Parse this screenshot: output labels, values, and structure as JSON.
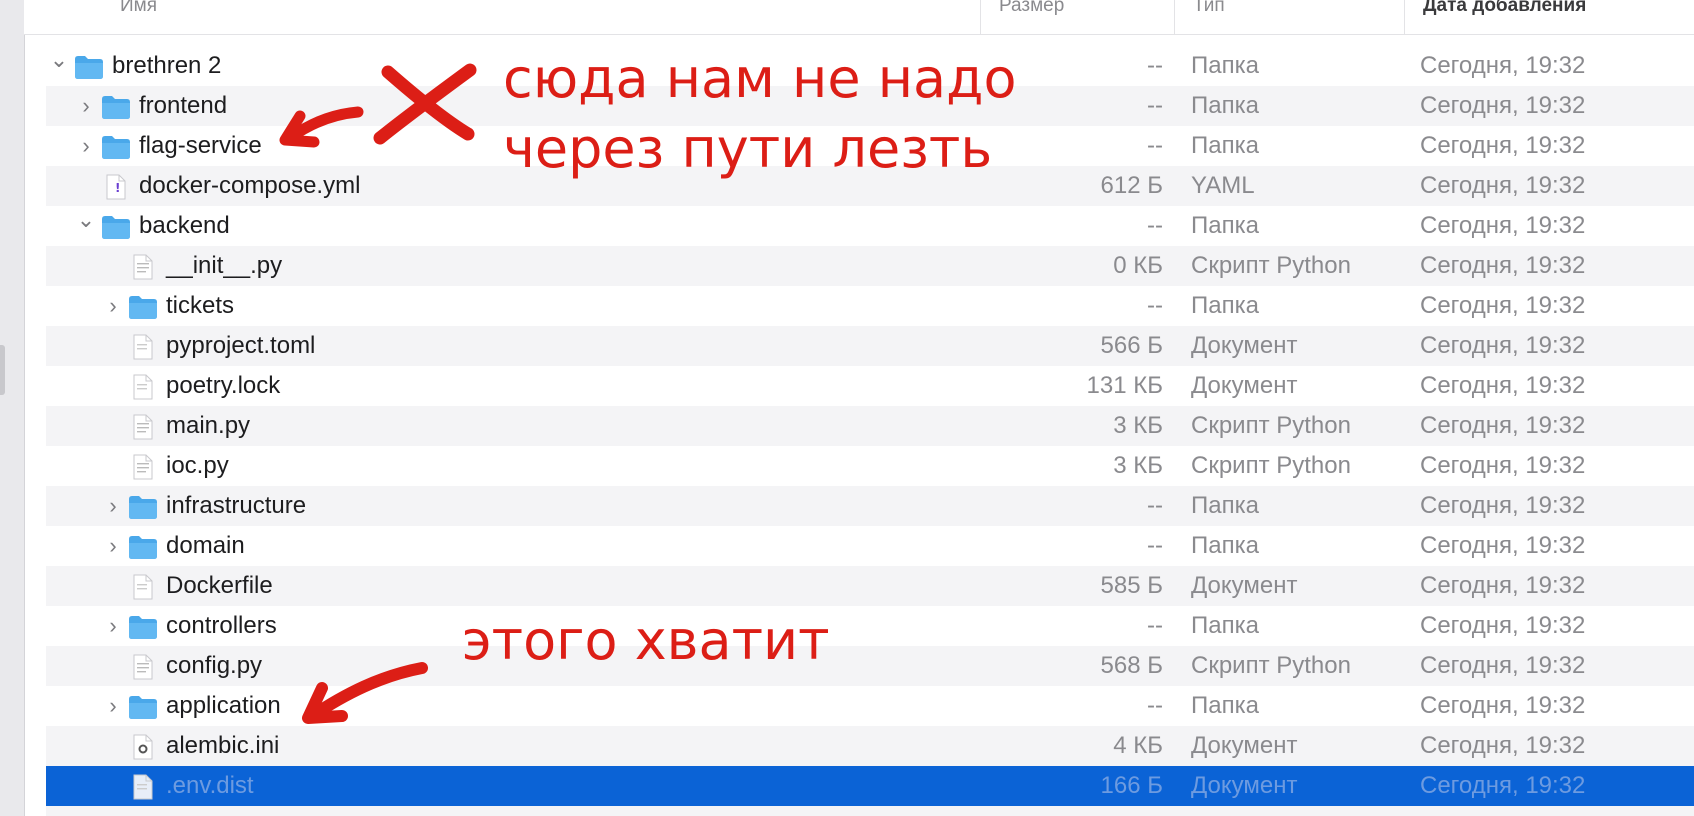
{
  "columns": {
    "name": "Имя",
    "size": "Размер",
    "kind": "Тип",
    "date": "Дата добавления"
  },
  "rows": [
    {
      "name": "brethren 2",
      "size": "--",
      "kind": "Папка",
      "date": "Сегодня, 19:32",
      "level": 0,
      "icon": "folder-icon",
      "disclosure": "expanded"
    },
    {
      "name": "frontend",
      "size": "--",
      "kind": "Папка",
      "date": "Сегодня, 19:32",
      "level": 1,
      "icon": "folder-icon",
      "disclosure": "collapsed"
    },
    {
      "name": "flag-service",
      "size": "--",
      "kind": "Папка",
      "date": "Сегодня, 19:32",
      "level": 1,
      "icon": "folder-icon",
      "disclosure": "collapsed"
    },
    {
      "name": "docker-compose.yml",
      "size": "612 Б",
      "kind": "YAML",
      "date": "Сегодня, 19:32",
      "level": 1,
      "icon": "yaml-file-icon",
      "disclosure": "none"
    },
    {
      "name": "backend",
      "size": "--",
      "kind": "Папка",
      "date": "Сегодня, 19:32",
      "level": 1,
      "icon": "folder-icon",
      "disclosure": "expanded"
    },
    {
      "name": "__init__.py",
      "size": "0 КБ",
      "kind": "Скрипт Python",
      "date": "Сегодня, 19:32",
      "level": 2,
      "icon": "python-file-icon",
      "disclosure": "none"
    },
    {
      "name": "tickets",
      "size": "--",
      "kind": "Папка",
      "date": "Сегодня, 19:32",
      "level": 2,
      "icon": "folder-icon",
      "disclosure": "collapsed"
    },
    {
      "name": "pyproject.toml",
      "size": "566 Б",
      "kind": "Документ",
      "date": "Сегодня, 19:32",
      "level": 2,
      "icon": "document-icon",
      "disclosure": "none"
    },
    {
      "name": "poetry.lock",
      "size": "131 КБ",
      "kind": "Документ",
      "date": "Сегодня, 19:32",
      "level": 2,
      "icon": "document-icon",
      "disclosure": "none"
    },
    {
      "name": "main.py",
      "size": "3 КБ",
      "kind": "Скрипт Python",
      "date": "Сегодня, 19:32",
      "level": 2,
      "icon": "python-file-icon",
      "disclosure": "none"
    },
    {
      "name": "ioc.py",
      "size": "3 КБ",
      "kind": "Скрипт Python",
      "date": "Сегодня, 19:32",
      "level": 2,
      "icon": "python-file-icon",
      "disclosure": "none"
    },
    {
      "name": "infrastructure",
      "size": "--",
      "kind": "Папка",
      "date": "Сегодня, 19:32",
      "level": 2,
      "icon": "folder-icon",
      "disclosure": "collapsed"
    },
    {
      "name": "domain",
      "size": "--",
      "kind": "Папка",
      "date": "Сегодня, 19:32",
      "level": 2,
      "icon": "folder-icon",
      "disclosure": "collapsed"
    },
    {
      "name": "Dockerfile",
      "size": "585 Б",
      "kind": "Документ",
      "date": "Сегодня, 19:32",
      "level": 2,
      "icon": "document-icon",
      "disclosure": "none"
    },
    {
      "name": "controllers",
      "size": "--",
      "kind": "Папка",
      "date": "Сегодня, 19:32",
      "level": 2,
      "icon": "folder-icon",
      "disclosure": "collapsed"
    },
    {
      "name": "config.py",
      "size": "568 Б",
      "kind": "Скрипт Python",
      "date": "Сегодня, 19:32",
      "level": 2,
      "icon": "python-file-icon",
      "disclosure": "none"
    },
    {
      "name": "application",
      "size": "--",
      "kind": "Папка",
      "date": "Сегодня, 19:32",
      "level": 2,
      "icon": "folder-icon",
      "disclosure": "collapsed"
    },
    {
      "name": "alembic.ini",
      "size": "4 КБ",
      "kind": "Документ",
      "date": "Сегодня, 19:32",
      "level": 2,
      "icon": "settings-file-icon",
      "disclosure": "none"
    },
    {
      "name": ".env.dist",
      "size": "166 Б",
      "kind": "Документ",
      "date": "Сегодня, 19:32",
      "level": 2,
      "icon": "document-icon",
      "disclosure": "none",
      "selected": true
    }
  ],
  "annotations": {
    "note1_line1": "сюда нам не надо",
    "note1_line2": "через пути лезть",
    "note2": "этого хватит",
    "color": "#dc1e16"
  },
  "colors": {
    "selection": "#0b63d6",
    "folder": "#4aa8ea",
    "alt_row": "#f4f4f6"
  }
}
